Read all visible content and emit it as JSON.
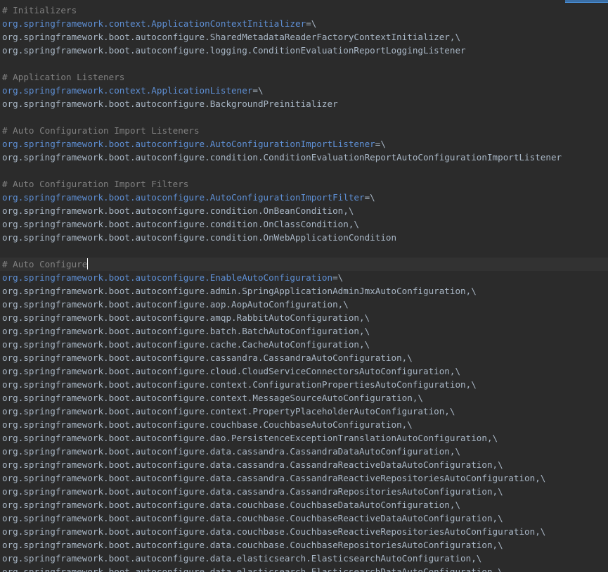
{
  "editor": {
    "lines": [
      {
        "type": "comment",
        "text": "# Initializers"
      },
      {
        "type": "key",
        "text": "org.springframework.context.ApplicationContextInitializer=\\"
      },
      {
        "type": "value",
        "text": "org.springframework.boot.autoconfigure.SharedMetadataReaderFactoryContextInitializer,\\"
      },
      {
        "type": "value",
        "text": "org.springframework.boot.autoconfigure.logging.ConditionEvaluationReportLoggingListener"
      },
      {
        "type": "blank",
        "text": ""
      },
      {
        "type": "comment",
        "text": "# Application Listeners"
      },
      {
        "type": "key",
        "text": "org.springframework.context.ApplicationListener=\\"
      },
      {
        "type": "value",
        "text": "org.springframework.boot.autoconfigure.BackgroundPreinitializer"
      },
      {
        "type": "blank",
        "text": ""
      },
      {
        "type": "comment",
        "text": "# Auto Configuration Import Listeners"
      },
      {
        "type": "key",
        "text": "org.springframework.boot.autoconfigure.AutoConfigurationImportListener=\\"
      },
      {
        "type": "value",
        "text": "org.springframework.boot.autoconfigure.condition.ConditionEvaluationReportAutoConfigurationImportListener"
      },
      {
        "type": "blank",
        "text": ""
      },
      {
        "type": "comment",
        "text": "# Auto Configuration Import Filters"
      },
      {
        "type": "key",
        "text": "org.springframework.boot.autoconfigure.AutoConfigurationImportFilter=\\"
      },
      {
        "type": "value",
        "text": "org.springframework.boot.autoconfigure.condition.OnBeanCondition,\\"
      },
      {
        "type": "value",
        "text": "org.springframework.boot.autoconfigure.condition.OnClassCondition,\\"
      },
      {
        "type": "value",
        "text": "org.springframework.boot.autoconfigure.condition.OnWebApplicationCondition"
      },
      {
        "type": "blank",
        "text": ""
      },
      {
        "type": "comment",
        "text": "# Auto Configure",
        "current": true
      },
      {
        "type": "key",
        "text": "org.springframework.boot.autoconfigure.EnableAutoConfiguration=\\"
      },
      {
        "type": "value",
        "text": "org.springframework.boot.autoconfigure.admin.SpringApplicationAdminJmxAutoConfiguration,\\"
      },
      {
        "type": "value",
        "text": "org.springframework.boot.autoconfigure.aop.AopAutoConfiguration,\\"
      },
      {
        "type": "value",
        "text": "org.springframework.boot.autoconfigure.amqp.RabbitAutoConfiguration,\\"
      },
      {
        "type": "value",
        "text": "org.springframework.boot.autoconfigure.batch.BatchAutoConfiguration,\\"
      },
      {
        "type": "value",
        "text": "org.springframework.boot.autoconfigure.cache.CacheAutoConfiguration,\\"
      },
      {
        "type": "value",
        "text": "org.springframework.boot.autoconfigure.cassandra.CassandraAutoConfiguration,\\"
      },
      {
        "type": "value",
        "text": "org.springframework.boot.autoconfigure.cloud.CloudServiceConnectorsAutoConfiguration,\\"
      },
      {
        "type": "value",
        "text": "org.springframework.boot.autoconfigure.context.ConfigurationPropertiesAutoConfiguration,\\"
      },
      {
        "type": "value",
        "text": "org.springframework.boot.autoconfigure.context.MessageSourceAutoConfiguration,\\"
      },
      {
        "type": "value",
        "text": "org.springframework.boot.autoconfigure.context.PropertyPlaceholderAutoConfiguration,\\"
      },
      {
        "type": "value",
        "text": "org.springframework.boot.autoconfigure.couchbase.CouchbaseAutoConfiguration,\\"
      },
      {
        "type": "value",
        "text": "org.springframework.boot.autoconfigure.dao.PersistenceExceptionTranslationAutoConfiguration,\\"
      },
      {
        "type": "value",
        "text": "org.springframework.boot.autoconfigure.data.cassandra.CassandraDataAutoConfiguration,\\"
      },
      {
        "type": "value",
        "text": "org.springframework.boot.autoconfigure.data.cassandra.CassandraReactiveDataAutoConfiguration,\\"
      },
      {
        "type": "value",
        "text": "org.springframework.boot.autoconfigure.data.cassandra.CassandraReactiveRepositoriesAutoConfiguration,\\"
      },
      {
        "type": "value",
        "text": "org.springframework.boot.autoconfigure.data.cassandra.CassandraRepositoriesAutoConfiguration,\\"
      },
      {
        "type": "value",
        "text": "org.springframework.boot.autoconfigure.data.couchbase.CouchbaseDataAutoConfiguration,\\"
      },
      {
        "type": "value",
        "text": "org.springframework.boot.autoconfigure.data.couchbase.CouchbaseReactiveDataAutoConfiguration,\\"
      },
      {
        "type": "value",
        "text": "org.springframework.boot.autoconfigure.data.couchbase.CouchbaseReactiveRepositoriesAutoConfiguration,\\"
      },
      {
        "type": "value",
        "text": "org.springframework.boot.autoconfigure.data.couchbase.CouchbaseRepositoriesAutoConfiguration,\\"
      },
      {
        "type": "value",
        "text": "org.springframework.boot.autoconfigure.data.elasticsearch.ElasticsearchAutoConfiguration,\\"
      },
      {
        "type": "value",
        "text": "org.springframework.boot.autoconfigure.data.elasticsearch.ElasticsearchDataAutoConfiguration,\\"
      }
    ]
  },
  "colors": {
    "background": "#2b2b2b",
    "comment": "#808080",
    "key": "#5e8fd4",
    "value": "#a9b7c6",
    "current_line": "#323232"
  }
}
